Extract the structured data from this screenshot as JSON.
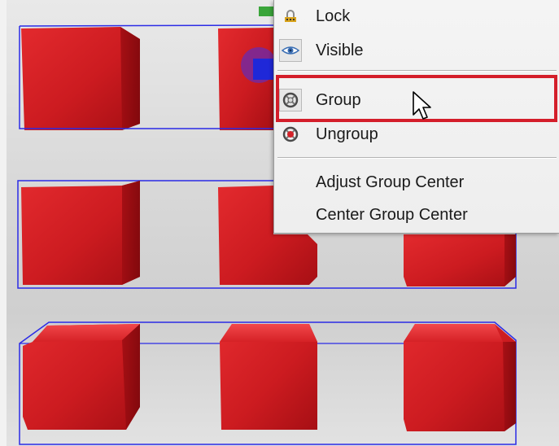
{
  "colors": {
    "cube_red": "#c8191f",
    "bbox_blue": "#2b2be6",
    "highlight_red": "#d41e2a"
  },
  "context_menu": {
    "items": [
      {
        "label": "Lock",
        "icon": "lock-icon"
      },
      {
        "label": "Visible",
        "icon": "eye-icon"
      },
      {
        "label": "Group",
        "icon": "group-icon"
      },
      {
        "label": "Ungroup",
        "icon": "ungroup-icon"
      },
      {
        "label": "Adjust Group Center",
        "icon": ""
      },
      {
        "label": "Center Group Center",
        "icon": ""
      }
    ],
    "highlighted": "Group"
  }
}
